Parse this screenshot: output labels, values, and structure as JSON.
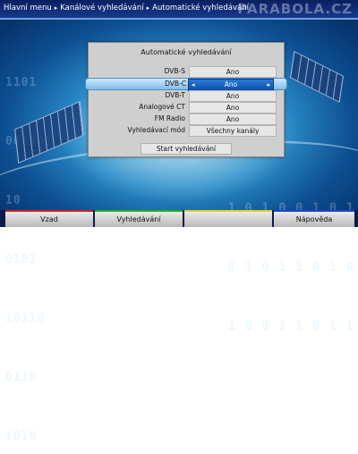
{
  "header": {
    "breadcrumb": [
      "Hlavní menu",
      "Kanálové vyhledávání",
      "Automatické vyhledávání"
    ],
    "watermark": "PARABOLA.CZ"
  },
  "dialog": {
    "title": "Automatické vyhledávání",
    "rows": [
      {
        "label": "DVB-S",
        "value": "Ano"
      },
      {
        "label": "DVB-C",
        "value": "Ano"
      },
      {
        "label": "DVB-T",
        "value": "Ano"
      },
      {
        "label": "Analogové CT",
        "value": "Ano"
      },
      {
        "label": "FM Radio",
        "value": "Ano"
      },
      {
        "label": "Vyhledávací mód",
        "value": "Všechny kanály"
      }
    ],
    "selected_row": "DVB-C",
    "start_button": "Start vyhledávání"
  },
  "footer": {
    "keys": [
      {
        "label": "Vzad",
        "color": "#d02020"
      },
      {
        "label": "Vyhledávání",
        "color": "#20b020"
      },
      {
        "label": "",
        "color": "#e0d020"
      },
      {
        "label": "Nápověda",
        "color": "#2040d0"
      }
    ]
  },
  "background": {
    "binary_left": [
      "1101",
      "001001",
      "10",
      "0101",
      "10110",
      "0110",
      "1010"
    ],
    "binary_right": [
      "1 0 1 0 0 1 0 1",
      "0 1 0 1 1 0 1 0",
      "1 0 0 1 1 0 1 1"
    ]
  },
  "icons": {
    "left_arrow": "◂",
    "right_arrow": "▸",
    "breadcrumb_sep": "▸"
  }
}
